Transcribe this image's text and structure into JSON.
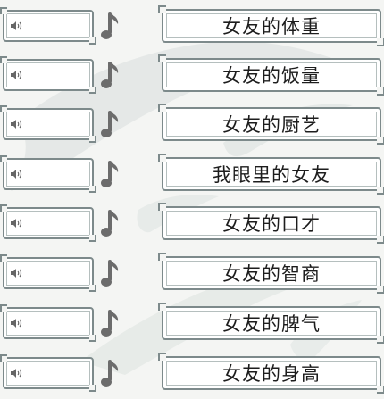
{
  "colors": {
    "card_border": "#7d8a8b",
    "card_fill": "#ffffff",
    "note_icon": "#6c6c6c",
    "text": "#1d1d1d",
    "background": "#f4f5f3",
    "ink_wash": "#9fb2b1"
  },
  "icons": {
    "sound": "speaker-icon",
    "music": "music-note-icon"
  },
  "rows": [
    {
      "answer": "女友的体重"
    },
    {
      "answer": "女友的饭量"
    },
    {
      "answer": "女友的厨艺"
    },
    {
      "answer": "我眼里的女友"
    },
    {
      "answer": "女友的口才"
    },
    {
      "answer": "女友的智商"
    },
    {
      "answer": "女友的脾气"
    },
    {
      "answer": "女友的身高"
    }
  ]
}
